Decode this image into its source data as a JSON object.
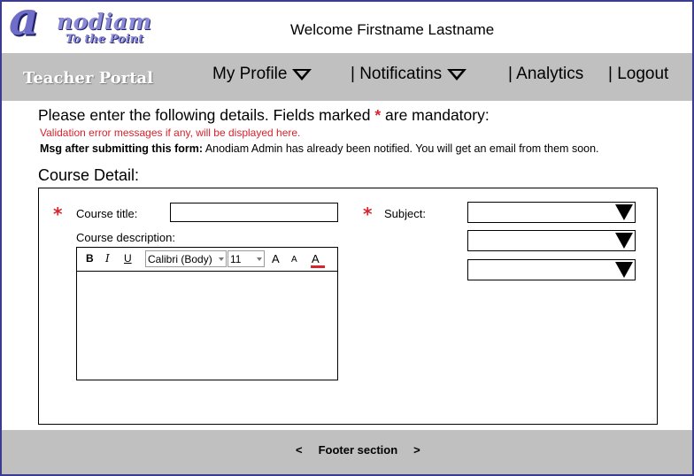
{
  "header": {
    "logo_letter": "a",
    "logo_text": "nodiam",
    "logo_tagline": "To the Point",
    "welcome": "Welcome Firstname Lastname"
  },
  "nav": {
    "portal_title": "Teacher Portal",
    "items": [
      {
        "label": "My Profile",
        "has_dropdown": true
      },
      {
        "label": "| Notificatins",
        "has_dropdown": true
      },
      {
        "label": "| Analytics",
        "has_dropdown": false
      },
      {
        "label": "| Logout",
        "has_dropdown": false
      }
    ]
  },
  "intro": {
    "text_before": "Please enter the following details. Fields marked ",
    "star": "*",
    "text_after": " are mandatory:",
    "validation": "Validation error messages if any, will be displayed here.",
    "msg_label": "Msg after submitting this form:",
    "msg_text": " Anodiam Admin has already  been notified. You will get an email from them soon."
  },
  "course": {
    "section_title": "Course Detail:",
    "star": "*",
    "title_label": "Course title:",
    "title_value": "",
    "description_label": "Course description:",
    "description_value": "",
    "subject_label": "Subject:",
    "subject_values": [
      "",
      "",
      ""
    ],
    "editor": {
      "bold": "B",
      "italic": "I",
      "underline": "U",
      "font_family": "Calibri (Body)",
      "font_size": "11",
      "grow_font": "A",
      "shrink_font": "A",
      "font_color": "A"
    }
  },
  "footer": {
    "prev": "<",
    "label": "Footer section",
    "next": ">"
  },
  "colors": {
    "accent_red": "#d9232e",
    "nav_bg": "#c0c0c0",
    "logo_blue": "#6e6ec9"
  }
}
